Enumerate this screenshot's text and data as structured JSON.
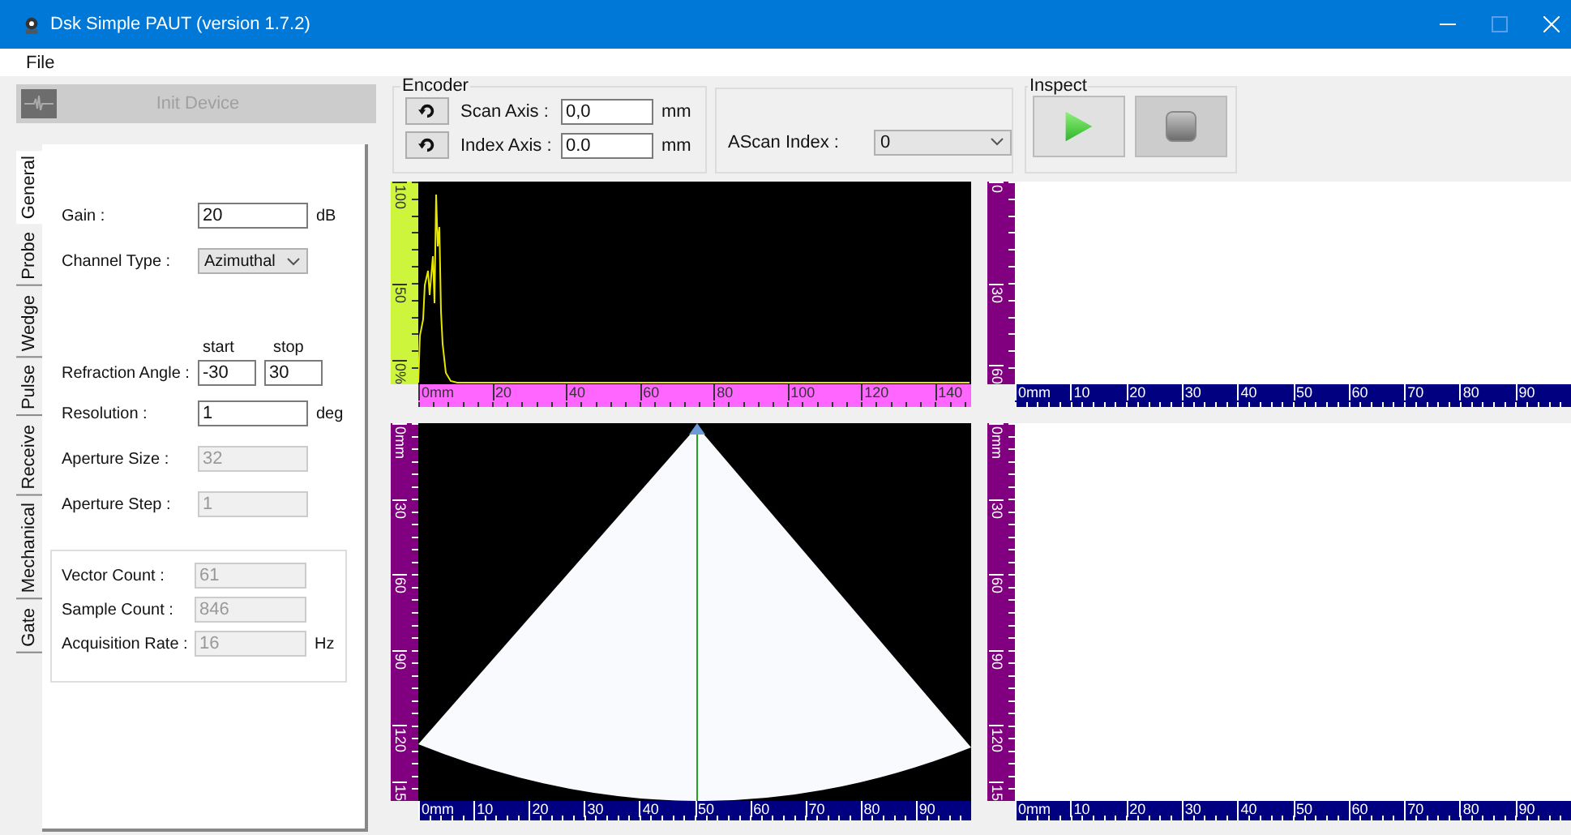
{
  "window": {
    "title": "Dsk Simple PAUT (version 1.7.2)"
  },
  "menu": [
    "File"
  ],
  "init_button": {
    "label": "Init Device",
    "disabled": true
  },
  "tabs": [
    {
      "label": "General",
      "selected": true
    },
    {
      "label": "Probe",
      "selected": false
    },
    {
      "label": "Wedge",
      "selected": false
    },
    {
      "label": "Pulse",
      "selected": false
    },
    {
      "label": "Receive",
      "selected": false
    },
    {
      "label": "Mechanical",
      "selected": false
    },
    {
      "label": "Gate",
      "selected": false
    }
  ],
  "general": {
    "fields": [
      {
        "kind": "input",
        "label": "Gain :",
        "value": "20",
        "unit": "dB",
        "disabled": false
      },
      {
        "kind": "select",
        "label": "Channel Type :",
        "value": "Azimuthal"
      },
      {
        "kind": "range",
        "label": "Refraction Angle :",
        "start_caption": "start",
        "stop_caption": "stop",
        "start": "-30",
        "stop": "30"
      },
      {
        "kind": "input",
        "label": "Resolution :",
        "value": "1",
        "unit": "deg",
        "disabled": false
      },
      {
        "kind": "input",
        "label": "Aperture Size :",
        "value": "32",
        "disabled": true
      },
      {
        "kind": "input",
        "label": "Aperture Step :",
        "value": "1",
        "disabled": true
      }
    ],
    "info": [
      {
        "label": "Vector Count :",
        "value": "61"
      },
      {
        "label": "Sample Count :",
        "value": "846"
      },
      {
        "label": "Acquisition Rate :",
        "value": "16",
        "unit": "Hz"
      }
    ]
  },
  "encoder": {
    "title": "Encoder",
    "axes": [
      {
        "label": "Scan Axis :",
        "value": "0,0",
        "unit": "mm"
      },
      {
        "label": "Index Axis :",
        "value": "0.0",
        "unit": "mm"
      }
    ]
  },
  "ascan_index": {
    "label": "AScan Index :",
    "value": "0"
  },
  "inspect": {
    "title": "Inspect",
    "buttons": [
      {
        "kind": "play",
        "disabled": false
      },
      {
        "kind": "stop",
        "disabled": true
      }
    ]
  },
  "plots": [
    {
      "kind": "ascan",
      "y_labels": [
        "100",
        "50",
        "0%"
      ],
      "x_labels": [
        "0mm",
        "20",
        "40",
        "60",
        "80",
        "100",
        "120",
        "140"
      ]
    },
    {
      "kind": "empty",
      "y_labels": [
        "0",
        "30",
        "60"
      ],
      "x_labels": [
        "0mm",
        "10",
        "20",
        "30",
        "40",
        "50",
        "60",
        "70",
        "80",
        "90"
      ]
    },
    {
      "kind": "sector",
      "y_labels": [
        "0mm",
        "30",
        "60",
        "90",
        "120",
        "15"
      ],
      "x_labels": [
        "0mm",
        "10",
        "20",
        "30",
        "40",
        "50",
        "60",
        "70",
        "80",
        "90"
      ]
    },
    {
      "kind": "empty",
      "y_labels": [
        "0mm",
        "30",
        "60",
        "90",
        "120",
        "15"
      ],
      "x_labels": [
        "0mm",
        "10",
        "20",
        "30",
        "40",
        "50",
        "60",
        "70",
        "80",
        "90"
      ]
    }
  ]
}
